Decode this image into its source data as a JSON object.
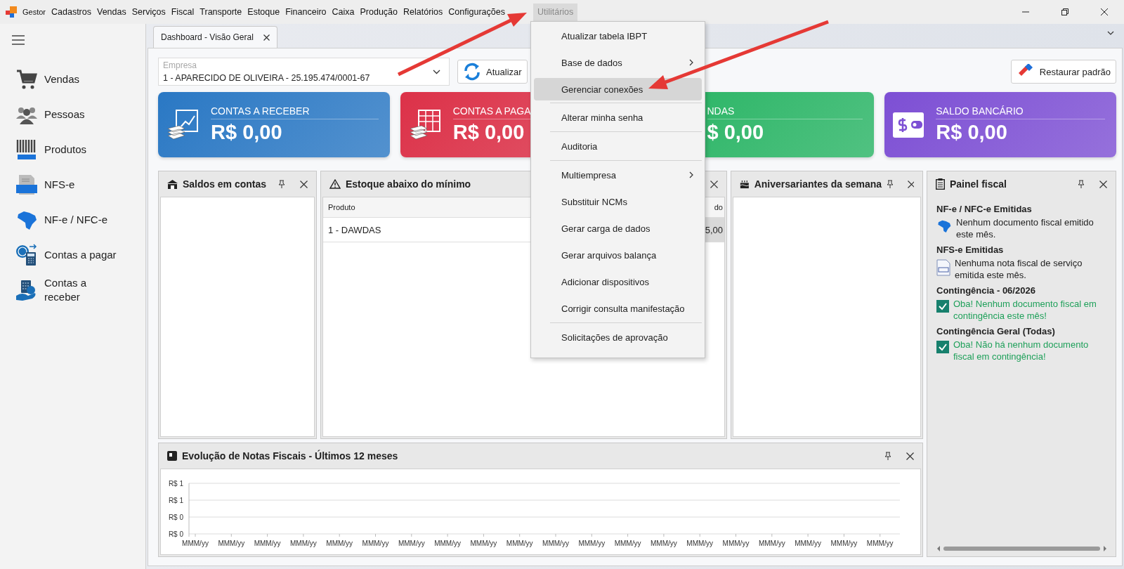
{
  "menu_bar": {
    "items": [
      {
        "label": "Gestor",
        "selected": false
      },
      {
        "label": "Cadastros",
        "selected": false
      },
      {
        "label": "Vendas",
        "selected": false
      },
      {
        "label": "Serviços",
        "selected": false
      },
      {
        "label": "Fiscal",
        "selected": false
      },
      {
        "label": "Transporte",
        "selected": false
      },
      {
        "label": "Estoque",
        "selected": false
      },
      {
        "label": "Financeiro",
        "selected": false
      },
      {
        "label": "Caixa",
        "selected": false
      },
      {
        "label": "Produção",
        "selected": false
      },
      {
        "label": "Relatórios",
        "selected": false
      },
      {
        "label": "Configurações",
        "selected": false
      },
      {
        "label": "Utilitários",
        "selected": true
      }
    ]
  },
  "sidebar": {
    "items": [
      {
        "label": "Vendas"
      },
      {
        "label": "Pessoas"
      },
      {
        "label": "Produtos"
      },
      {
        "label": "NFS-e"
      },
      {
        "label": "NF-e / NFC-e"
      },
      {
        "label": "Contas a pagar"
      },
      {
        "label": "Contas a receber"
      }
    ]
  },
  "tabs": [
    {
      "label": "Dashboard - Visão Geral",
      "selected": true
    }
  ],
  "toolbar": {
    "company_field": {
      "label": "Empresa",
      "value": "1 - APARECIDO DE OLIVEIRA - 25.195.474/0001-67"
    },
    "refresh_button": "Atualizar",
    "restore_button": "Restaurar padrão"
  },
  "cards": [
    {
      "title": "CONTAS A RECEBER",
      "value": "R$ 0,00",
      "color": "#2a78c4",
      "icon_shown": true
    },
    {
      "title": "CONTAS A PAGA",
      "value": "R$ 0,00",
      "color": "#dc3148",
      "icon_shown": true
    },
    {
      "title": "NDAS",
      "value": "$ 0,00",
      "color": "#27b463",
      "icon_shown": false
    },
    {
      "title": "SALDO BANCÁRIO",
      "value": "R$ 0,00",
      "color": "#7d4fd4",
      "icon_shown": true
    }
  ],
  "balances_panel": {
    "title": "Saldos em contas"
  },
  "stock_panel": {
    "title": "Estoque abaixo do mínimo",
    "columns": [
      "Produto",
      "do"
    ],
    "rows": [
      [
        "1 - DAWDAS",
        "5,00"
      ]
    ]
  },
  "birthdays_panel": {
    "title": "Aniversariantes da semana"
  },
  "fiscal_panel": {
    "title": "Painel fiscal",
    "sections": [
      {
        "heading": "NF-e / NFC-e Emitidas",
        "kind": "nfe",
        "message": "Nenhum documento fiscal emitido este mês."
      },
      {
        "heading": "NFS-e Emitidas",
        "kind": "nfse",
        "message": "Nenhuma nota fiscal de serviço emitida este mês."
      },
      {
        "heading": "Contingência - 06/2026",
        "kind": "ok",
        "message": "Oba! Nenhum documento fiscal em contingência este mês!"
      },
      {
        "heading": "Contingência Geral (Todas)",
        "kind": "ok",
        "message": "Oba! Não há nenhum documento fiscal em contingência!"
      }
    ]
  },
  "chart_panel": {
    "title": "Evolução de Notas Fiscais - Últimos 12 meses",
    "x_axis_labels": [
      "MMM/yy",
      "MMM/yy",
      "MMM/yy",
      "MMM/yy",
      "MMM/yy",
      "MMM/yy",
      "MMM/yy",
      "MMM/yy",
      "MMM/yy",
      "MMM/yy",
      "MMM/yy",
      "MMM/yy",
      "MMM/yy",
      "MMM/yy",
      "MMM/yy",
      "MMM/yy",
      "MMM/yy",
      "MMM/yy",
      "MMM/yy",
      "MMM/yy"
    ],
    "y_axis_labels": [
      "R$ 1",
      "R$ 1",
      "R$ 0",
      "R$ 0"
    ]
  },
  "utilities_menu": {
    "items": [
      {
        "kind": "item",
        "label": "Atualizar tabela IBPT",
        "submenu": false,
        "selected": false
      },
      {
        "kind": "item",
        "label": "Base de dados",
        "submenu": true,
        "selected": false
      },
      {
        "kind": "item",
        "label": "Gerenciar conexões",
        "submenu": false,
        "selected": true
      },
      {
        "kind": "separator"
      },
      {
        "kind": "item",
        "label": "Alterar minha senha",
        "submenu": false,
        "selected": false
      },
      {
        "kind": "separator"
      },
      {
        "kind": "item",
        "label": "Auditoria",
        "submenu": false,
        "selected": false
      },
      {
        "kind": "separator"
      },
      {
        "kind": "item",
        "label": "Multiempresa",
        "submenu": true,
        "selected": false
      },
      {
        "kind": "item",
        "label": "Substituir NCMs",
        "submenu": false,
        "selected": false
      },
      {
        "kind": "item",
        "label": "Gerar carga de dados",
        "submenu": false,
        "selected": false
      },
      {
        "kind": "item",
        "label": "Gerar arquivos balança",
        "submenu": false,
        "selected": false
      },
      {
        "kind": "item",
        "label": "Adicionar dispositivos",
        "submenu": false,
        "selected": false
      },
      {
        "kind": "item",
        "label": "Corrigir consulta manifestação",
        "submenu": false,
        "selected": false
      },
      {
        "kind": "separator"
      },
      {
        "kind": "item",
        "label": "Solicitações de aprovação",
        "submenu": false,
        "selected": false
      }
    ]
  }
}
